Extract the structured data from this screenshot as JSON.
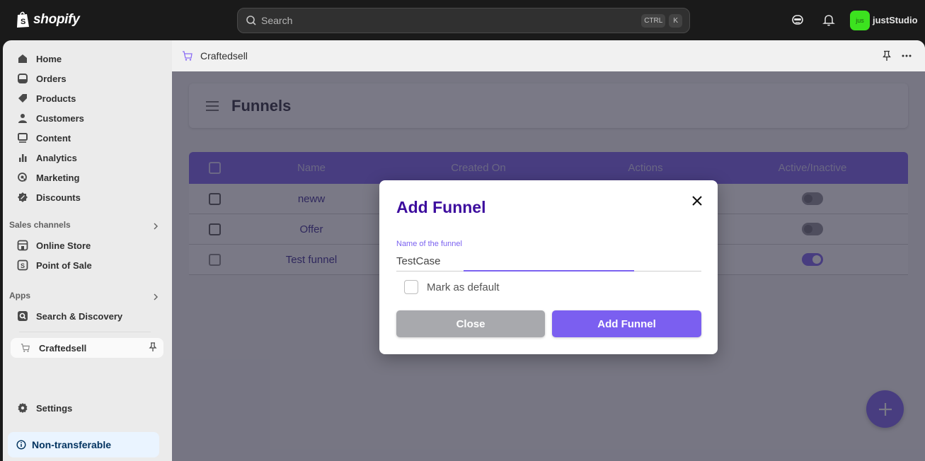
{
  "topbar": {
    "brand": "shopify",
    "search": {
      "placeholder": "Search",
      "shortcut_keys": [
        "CTRL",
        "K"
      ]
    },
    "icons": [
      "assistant-icon",
      "bell-icon"
    ],
    "store": {
      "avatar_initials": "jus",
      "name": "justStudio",
      "avatar_color": "#3ce21f"
    }
  },
  "sidebar": {
    "items": [
      {
        "label": "Home",
        "icon": "home-icon"
      },
      {
        "label": "Orders",
        "icon": "orders-icon"
      },
      {
        "label": "Products",
        "icon": "tag-icon"
      },
      {
        "label": "Customers",
        "icon": "person-icon"
      },
      {
        "label": "Content",
        "icon": "content-icon"
      },
      {
        "label": "Analytics",
        "icon": "bar-chart-icon"
      },
      {
        "label": "Marketing",
        "icon": "target-icon"
      },
      {
        "label": "Discounts",
        "icon": "discount-icon"
      }
    ],
    "sales_channels": {
      "title": "Sales channels",
      "items": [
        {
          "label": "Online Store",
          "icon": "store-icon"
        },
        {
          "label": "Point of Sale",
          "icon": "pos-icon"
        }
      ]
    },
    "apps": {
      "title": "Apps",
      "items": [
        {
          "label": "Search & Discovery",
          "icon": "search-discovery-icon"
        }
      ],
      "active_app": {
        "label": "Craftedsell",
        "icon": "cart-icon"
      }
    },
    "settings_label": "Settings",
    "notice": "Non-transferable"
  },
  "app": {
    "header_title": "Craftedsell",
    "page_title": "Funnels",
    "table": {
      "columns": [
        "Name",
        "Created On",
        "Actions",
        "Active/Inactive"
      ],
      "rows": [
        {
          "name": "neww",
          "active": false
        },
        {
          "name": "Offer",
          "active": false
        },
        {
          "name": "Test funnel",
          "active": true
        }
      ]
    },
    "accent_color": "#7b62f0"
  },
  "modal": {
    "title": "Add Funnel",
    "field_label": "Name of the funnel",
    "field_value": "TestCase",
    "checkbox_label": "Mark as default",
    "checkbox_checked": false,
    "close_label": "Close",
    "submit_label": "Add Funnel"
  }
}
